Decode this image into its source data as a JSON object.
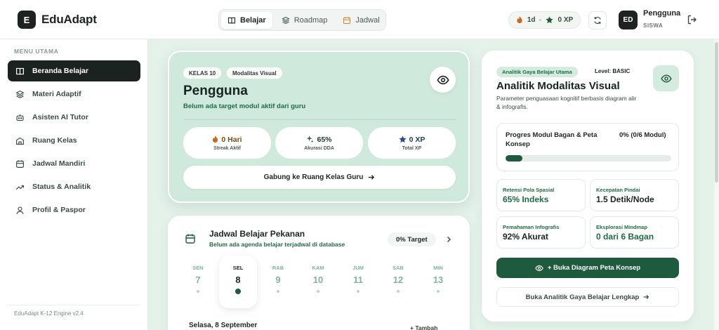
{
  "brand": {
    "logo_letter": "E",
    "name": "EduAdapt"
  },
  "nav": {
    "tabs": [
      {
        "label": "Belajar",
        "icon": "book-icon",
        "active": true
      },
      {
        "label": "Roadmap",
        "icon": "layers-icon",
        "active": false
      },
      {
        "label": "Jadwal",
        "icon": "calendar-icon",
        "active": false
      }
    ]
  },
  "header": {
    "streak": "1d",
    "xp": "0 XP",
    "avatar_initials": "ED",
    "user_name": "Pengguna",
    "user_role": "SISWA"
  },
  "sidebar": {
    "section_title": "MENU UTAMA",
    "items": [
      {
        "label": "Beranda Belajar",
        "icon": "book-open-icon",
        "active": true
      },
      {
        "label": "Materi Adaptif",
        "icon": "layers-icon",
        "active": false
      },
      {
        "label": "Asisten AI Tutor",
        "icon": "robot-icon",
        "active": false
      },
      {
        "label": "Ruang Kelas",
        "icon": "school-icon",
        "active": false
      },
      {
        "label": "Jadwal Mandiri",
        "icon": "calendar-icon",
        "active": false
      },
      {
        "label": "Status & Analitik",
        "icon": "trend-icon",
        "active": false
      },
      {
        "label": "Profil & Paspor",
        "icon": "user-icon",
        "active": false
      }
    ],
    "footer": "EduAdapt K-12 Engine v2.4"
  },
  "hero": {
    "chips": [
      "KELAS 10",
      "Modalitas Visual"
    ],
    "title": "Pengguna",
    "subtitle": "Belum ada target modul aktif dari guru",
    "stats": [
      {
        "value": "0 Hari",
        "label": "Streak Aktif",
        "icon": "flame-icon"
      },
      {
        "value": "65%",
        "label": "Akurasi DDA",
        "icon": "sparkle-icon"
      },
      {
        "value": "0 XP",
        "label": "Total XP",
        "icon": "star-icon"
      }
    ],
    "join_button": "Gabung ke Ruang Kelas Guru"
  },
  "schedule": {
    "title": "Jadwal Belajar Pekanan",
    "subtitle": "Belum ada agenda belajar terjadwal di database",
    "target": "0% Target",
    "days": [
      {
        "name": "SEN",
        "num": "7",
        "active": false
      },
      {
        "name": "SEL",
        "num": "8",
        "active": true
      },
      {
        "name": "RAB",
        "num": "9",
        "active": false
      },
      {
        "name": "KAM",
        "num": "10",
        "active": false
      },
      {
        "name": "JUM",
        "num": "11",
        "active": false
      },
      {
        "name": "SAB",
        "num": "12",
        "active": false
      },
      {
        "name": "MIN",
        "num": "13",
        "active": false
      }
    ],
    "selected_date": "Selasa, 8 September",
    "add_label": "+ Tambah"
  },
  "analytics": {
    "chip": "Analitik Gaya Belajar Utama",
    "level": "Level: BASIC",
    "title": "Analitik Modalitas Visual",
    "description": "Parameter penguasaan kognitif berbasis diagram alir & infografis.",
    "progress": {
      "label": "Progres Modul Bagan & Peta Konsep",
      "value_text": "0% (0/6 Modul)",
      "fill_percent": 10
    },
    "metrics": [
      {
        "label": "Retensi Pola Spasial",
        "value": "65% Indeks",
        "tone": "green"
      },
      {
        "label": "Kecepatan Pindai",
        "value": "1.5 Detik/Node",
        "tone": "dark"
      },
      {
        "label": "Pemahaman Infografis",
        "value": "92% Akurat",
        "tone": "dark"
      },
      {
        "label": "Eksplorasi Mindmap",
        "value": "0 dari 6 Bagan",
        "tone": "green"
      }
    ],
    "open_button": "+ Buka Diagram Peta Konsep",
    "full_link": "Buka Analitik Gaya Belajar Lengkap"
  },
  "colors": {
    "primary": "#1e5a3e",
    "accent_green": "#1f6b48",
    "hero_bg": "#cfe9dc",
    "sidebar_active": "#1c2220"
  }
}
